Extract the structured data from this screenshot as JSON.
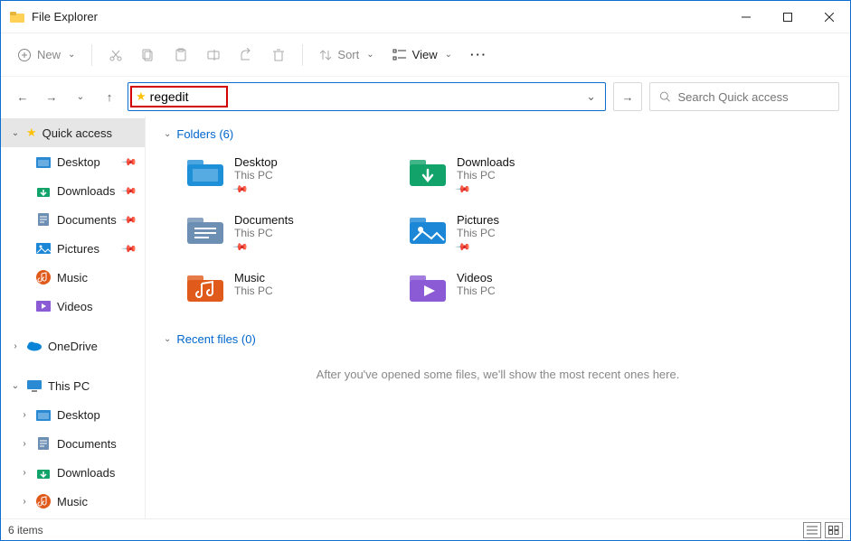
{
  "window": {
    "title": "File Explorer"
  },
  "toolbar": {
    "new": "New",
    "sort": "Sort",
    "view": "View"
  },
  "address": {
    "value": "regedit"
  },
  "search": {
    "placeholder": "Search Quick access"
  },
  "sidebar": {
    "quick_access": "Quick access",
    "items": [
      {
        "label": "Desktop",
        "pinned": true
      },
      {
        "label": "Downloads",
        "pinned": true
      },
      {
        "label": "Documents",
        "pinned": true
      },
      {
        "label": "Pictures",
        "pinned": true
      },
      {
        "label": "Music",
        "pinned": false
      },
      {
        "label": "Videos",
        "pinned": false
      }
    ],
    "onedrive": "OneDrive",
    "thispc": "This PC",
    "pc_items": [
      {
        "label": "Desktop"
      },
      {
        "label": "Documents"
      },
      {
        "label": "Downloads"
      },
      {
        "label": "Music"
      }
    ]
  },
  "content": {
    "folders_header": "Folders (6)",
    "recent_header": "Recent files (0)",
    "recent_empty": "After you've opened some files, we'll show the most recent ones here.",
    "folders": [
      {
        "name": "Desktop",
        "sub": "This PC",
        "pinned": true,
        "color": "#1e90d8"
      },
      {
        "name": "Downloads",
        "sub": "This PC",
        "pinned": true,
        "color": "#11a36a"
      },
      {
        "name": "Documents",
        "sub": "This PC",
        "pinned": true,
        "color": "#6c8fb3"
      },
      {
        "name": "Pictures",
        "sub": "This PC",
        "pinned": true,
        "color": "#1b87d6"
      },
      {
        "name": "Music",
        "sub": "This PC",
        "pinned": false,
        "color": "#e05a1b"
      },
      {
        "name": "Videos",
        "sub": "This PC",
        "pinned": false,
        "color": "#8b5bd6"
      }
    ]
  },
  "status": {
    "text": "6 items"
  }
}
